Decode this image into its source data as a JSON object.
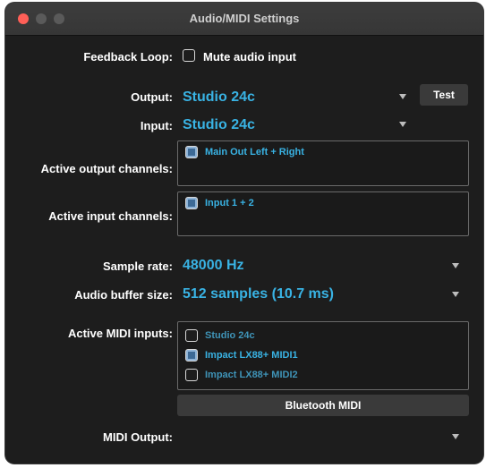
{
  "window": {
    "title": "Audio/MIDI Settings",
    "traffic_colors": {
      "close": "#ff5f57",
      "minimize": "#5a5a5a",
      "zoom": "#5a5a5a"
    }
  },
  "colors": {
    "accent": "#39b3e4",
    "dim_item": "#3f94b8",
    "background": "#1d1d1d"
  },
  "feedback": {
    "label": "Feedback Loop:",
    "checkbox_label": "Mute audio input",
    "checked": false
  },
  "output": {
    "label": "Output:",
    "value": "Studio 24c",
    "test_label": "Test"
  },
  "input": {
    "label": "Input:",
    "value": "Studio 24c"
  },
  "active_output": {
    "label": "Active output channels:",
    "items": [
      {
        "label": "Main Out Left + Right",
        "checked": true
      }
    ]
  },
  "active_input": {
    "label": "Active input channels:",
    "items": [
      {
        "label": "Input 1 + 2",
        "checked": true
      }
    ]
  },
  "sample_rate": {
    "label": "Sample rate:",
    "value": "48000 Hz"
  },
  "buffer_size": {
    "label": "Audio buffer size:",
    "value": "512 samples (10.7 ms)"
  },
  "midi_inputs": {
    "label": "Active MIDI inputs:",
    "items": [
      {
        "label": "Studio 24c",
        "checked": false
      },
      {
        "label": "Impact LX88+ MIDI1",
        "checked": true
      },
      {
        "label": "Impact LX88+ MIDI2",
        "checked": false
      }
    ]
  },
  "bluetooth": {
    "label": "Bluetooth MIDI"
  },
  "midi_output": {
    "label": "MIDI Output:",
    "value": ""
  }
}
